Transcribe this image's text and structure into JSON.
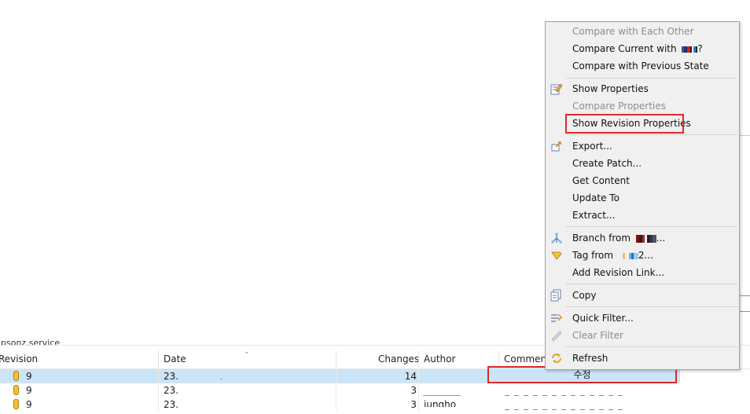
{
  "context_menu": {
    "items": [
      {
        "key": "compare_each_other",
        "label": "Compare with Each Other",
        "disabled": true
      },
      {
        "key": "compare_current",
        "label": "Compare Current with",
        "suffix": "?",
        "disabled": false
      },
      {
        "key": "compare_previous",
        "label": "Compare with Previous State",
        "disabled": false
      },
      {
        "key": "show_properties",
        "label": "Show Properties",
        "disabled": false,
        "icon": "properties-icon"
      },
      {
        "key": "compare_properties",
        "label": "Compare Properties",
        "disabled": true
      },
      {
        "key": "show_revision_properties",
        "label": "Show Revision Properties",
        "disabled": false,
        "highlighted": true
      },
      {
        "key": "export",
        "label": "Export...",
        "disabled": false,
        "icon": "export-icon"
      },
      {
        "key": "create_patch",
        "label": "Create Patch...",
        "disabled": false
      },
      {
        "key": "get_content",
        "label": "Get Content",
        "disabled": false
      },
      {
        "key": "update_to",
        "label": "Update To",
        "disabled": false
      },
      {
        "key": "extract",
        "label": "Extract...",
        "disabled": false
      },
      {
        "key": "branch_from",
        "label": "Branch from",
        "suffix": "...",
        "disabled": false,
        "icon": "branch-icon"
      },
      {
        "key": "tag_from",
        "label": "Tag from",
        "suffix": "2...",
        "disabled": false,
        "icon": "tag-icon"
      },
      {
        "key": "add_revision_link",
        "label": "Add Revision Link...",
        "disabled": false
      },
      {
        "key": "copy",
        "label": "Copy",
        "disabled": false,
        "icon": "copy-icon"
      },
      {
        "key": "quick_filter",
        "label": "Quick Filter...",
        "disabled": false,
        "icon": "filter-icon"
      },
      {
        "key": "clear_filter",
        "label": "Clear Filter",
        "disabled": true,
        "icon": "clear-filter-icon"
      },
      {
        "key": "refresh",
        "label": "Refresh",
        "disabled": false,
        "icon": "refresh-icon"
      }
    ]
  },
  "history": {
    "partial_title": "ipsonz.service",
    "columns": {
      "revision": "Revision",
      "date": "Date",
      "changes": "Changes",
      "author": "Author",
      "comment": "Comment"
    },
    "rows": [
      {
        "revision": "9",
        "date": "23.",
        "changes": "14",
        "author": "",
        "comment": "수정",
        "selected": true
      },
      {
        "revision": "9",
        "date": "23.",
        "changes": "3",
        "author": "",
        "comment": "",
        "selected": false
      },
      {
        "revision": "9",
        "date": "23.",
        "changes": "3",
        "author": "jungho",
        "comment": "",
        "selected": false
      }
    ]
  },
  "colors": {
    "highlight_border": "#e02828",
    "selection": "#cce4f7",
    "menu_bg": "#f0f0f0"
  }
}
